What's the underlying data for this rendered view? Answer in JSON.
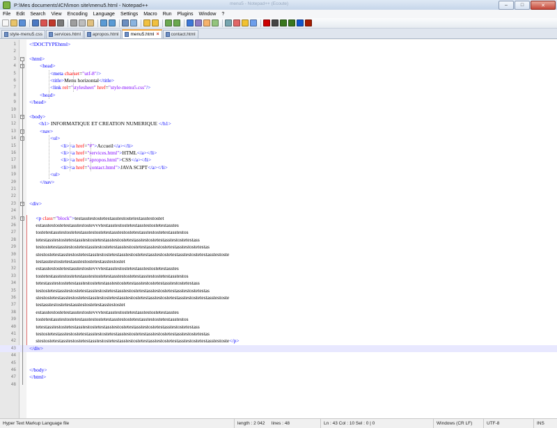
{
  "window": {
    "title": "P:\\Mes documents\\ICN\\mon site\\menu5.html - Notepad++",
    "ghost_title": "menu5 - Notepad++ (Ecoute)",
    "minimize": "–",
    "maximize": "□",
    "close": "✕"
  },
  "menu": [
    "File",
    "Edit",
    "Search",
    "View",
    "Encoding",
    "Language",
    "Settings",
    "Macro",
    "Run",
    "Plugins",
    "Window",
    "?"
  ],
  "toolbar": {
    "icons": [
      "new-file-icon",
      "open-file-icon",
      "save-icon",
      "save-all-icon",
      "close-icon",
      "close-all-icon",
      "print-icon",
      "cut-icon",
      "copy-icon",
      "paste-icon",
      "undo-icon",
      "redo-icon",
      "find-icon",
      "replace-icon",
      "zoom-in-icon",
      "zoom-out-icon",
      "sync-v-icon",
      "sync-h-icon",
      "word-wrap-icon",
      "show-all-icon",
      "indent-guide-icon",
      "user-lang-icon",
      "doc-map-icon",
      "function-list-icon",
      "folder-icon",
      "monitor-icon",
      "record-macro-icon",
      "stop-record-icon",
      "play-macro-icon",
      "run-macro-icon",
      "save-macro-icon",
      "abc-icon"
    ]
  },
  "tabs": [
    {
      "label": "style-menu5.css",
      "active": false
    },
    {
      "label": "services.html",
      "active": false
    },
    {
      "label": "apropos.html",
      "active": false
    },
    {
      "label": "menu5.html",
      "active": true
    },
    {
      "label": "contact.html",
      "active": false
    }
  ],
  "editor": {
    "current_line": 43,
    "lines": [
      [
        [
          "t",
          "<"
        ],
        [
          "t",
          "!DOCTYPEhtml"
        ],
        [
          "t",
          ">"
        ]
      ],
      [],
      [
        [
          "t",
          "<html>"
        ]
      ],
      [
        [
          "x",
          "        "
        ],
        [
          "t",
          "<head>"
        ]
      ],
      [
        [
          "x",
          "                "
        ],
        [
          "t",
          "<meta "
        ],
        [
          "a",
          "charset"
        ],
        [
          "x",
          "="
        ],
        [
          "v",
          "\"utf-8\""
        ],
        [
          "t",
          "/>"
        ]
      ],
      [
        [
          "x",
          "                "
        ],
        [
          "t",
          "<title>"
        ],
        [
          "x",
          "Menu horizontal"
        ],
        [
          "t",
          "</title>"
        ]
      ],
      [
        [
          "x",
          "                "
        ],
        [
          "t",
          "<link "
        ],
        [
          "a",
          "rel"
        ],
        [
          "x",
          "="
        ],
        [
          "v",
          "\"stylesheet\""
        ],
        [
          "x",
          " "
        ],
        [
          "a",
          "href"
        ],
        [
          "x",
          "="
        ],
        [
          "v",
          "\"style-menu5.css\""
        ],
        [
          "t",
          "/>"
        ]
      ],
      [
        [
          "x",
          "        "
        ],
        [
          "t",
          "<head>"
        ]
      ],
      [
        [
          "t",
          "</head>"
        ]
      ],
      [],
      [
        [
          "t",
          "<body>"
        ]
      ],
      [
        [
          "x",
          "       "
        ],
        [
          "t",
          "<h1>"
        ],
        [
          "x",
          " INFORMATIQUE ET CREATION NUMERIQUE "
        ],
        [
          "t",
          "</h1>"
        ]
      ],
      [
        [
          "x",
          "        "
        ],
        [
          "t",
          "<nav>"
        ]
      ],
      [
        [
          "x",
          "                "
        ],
        [
          "t",
          "<ul>"
        ]
      ],
      [
        [
          "x",
          "                        "
        ],
        [
          "t",
          "<li><a "
        ],
        [
          "a",
          "href"
        ],
        [
          "x",
          "="
        ],
        [
          "v",
          "\"#\""
        ],
        [
          "t",
          ">"
        ],
        [
          "x",
          "Accueil"
        ],
        [
          "t",
          "</a></li>"
        ]
      ],
      [
        [
          "x",
          "                        "
        ],
        [
          "t",
          "<li><a "
        ],
        [
          "a",
          "href"
        ],
        [
          "x",
          "="
        ],
        [
          "v",
          "\"services.html\""
        ],
        [
          "t",
          ">"
        ],
        [
          "x",
          "HTML"
        ],
        [
          "t",
          "</a></li>"
        ]
      ],
      [
        [
          "x",
          "                        "
        ],
        [
          "t",
          "<li><a "
        ],
        [
          "a",
          "href"
        ],
        [
          "x",
          "="
        ],
        [
          "v",
          "\"apropos.html\""
        ],
        [
          "t",
          ">"
        ],
        [
          "x",
          "CSS"
        ],
        [
          "t",
          "</a></li>"
        ]
      ],
      [
        [
          "x",
          "                        "
        ],
        [
          "t",
          "<li><a "
        ],
        [
          "a",
          "href"
        ],
        [
          "x",
          "="
        ],
        [
          "v",
          "\"contact.html\""
        ],
        [
          "t",
          ">"
        ],
        [
          "x",
          "JAVA SCIPT"
        ],
        [
          "t",
          "</a></li>"
        ]
      ],
      [
        [
          "x",
          "                "
        ],
        [
          "t",
          "<ul>"
        ]
      ],
      [
        [
          "x",
          "        "
        ],
        [
          "t",
          "</nav>"
        ]
      ],
      [],
      [],
      [
        [
          "t",
          "<div>"
        ]
      ],
      [],
      [
        [
          "x",
          "     "
        ],
        [
          "t",
          "<p "
        ],
        [
          "a",
          "class"
        ],
        [
          "x",
          "="
        ],
        [
          "v",
          "\"block\""
        ],
        [
          "t",
          ">"
        ],
        [
          "x",
          "testasstestostetestasstestostetestasstestostet"
        ]
      ],
      [
        [
          "x",
          "     estasstestostetestasstestostevvvtestasstestostetestasstestostetestasstes"
        ]
      ],
      [
        [
          "x",
          "     tostetestasstestostetestasstestostetestasstestostetestasstestostetestasstestos"
        ]
      ],
      [
        [
          "x",
          "     tetestasstestostetestasstestostetestasstestostetestasstestostetestasstestostetestass"
        ]
      ],
      [
        [
          "x",
          "     testostetestasstestostetestasstestostetestasstestostetestasstestostetestasstestostetestas"
        ]
      ],
      [
        [
          "x",
          "     stestostetestasstestostetestasstestostetestasstestostetestasstestostetestasstestostetestasstestoste"
        ]
      ],
      [
        [
          "x",
          "     testasstestostetestasstestostetestasstestostet"
        ]
      ],
      [
        [
          "x",
          "     estasstestostetestasstestostevvvtestasstestostetestasstestostetestasstes"
        ]
      ],
      [
        [
          "x",
          "     tostetestasstestostetestasstestostetestasstestostetestasstestostetestasstestos"
        ]
      ],
      [
        [
          "x",
          "     tetestasstestostetestasstestostetestasstestostetestasstestostetestasstestostetestass"
        ]
      ],
      [
        [
          "x",
          "     testostetestasstestostetestasstestostetestasstestostetestasstestostetestasstestostetestas"
        ]
      ],
      [
        [
          "x",
          "     stestostetestasstestostetestasstestostetestasstestostetestasstestostetestasstestostetestasstestoste"
        ]
      ],
      [
        [
          "x",
          "     testasstestostetestasstestostetestasstestostet"
        ]
      ],
      [
        [
          "x",
          "     estasstestostetestasstestostevvvtestasstestostetestasstestostetestasstes"
        ]
      ],
      [
        [
          "x",
          "     tostetestasstestostetestasstestostetestasstestostetestasstestostetestasstestos"
        ]
      ],
      [
        [
          "x",
          "     tetestasstestostetestasstestostetestasstestostetestasstestostetestasstestostetestass"
        ]
      ],
      [
        [
          "x",
          "     testostetestasstestostetestasstestostetestasstestostetestasstestostetestasstestostetestas"
        ]
      ],
      [
        [
          "x",
          "     stestostetestasstestostetestasstestostetestasstestostetestasstestostetestasstestostetestasstestoste"
        ],
        [
          "t",
          "</p>"
        ]
      ],
      [
        [
          "t",
          "</div>"
        ]
      ],
      [],
      [],
      [
        [
          "t",
          "</body>"
        ]
      ],
      [
        [
          "t",
          "</html>"
        ]
      ],
      []
    ]
  },
  "status": {
    "lang": "Hyper Text Markup Language file",
    "length": "length : 2 042",
    "lines": "lines : 48",
    "pos": "Ln : 43    Col : 10    Sel : 0 | 0",
    "eol": "Windows (CR LF)",
    "encoding": "UTF-8",
    "mode": "INS"
  },
  "colors": {
    "tag": "#0000ff",
    "attr": "#ff0000",
    "value": "#8000ff",
    "current_line": "#e8e8ff",
    "accent": "#f2a33a"
  }
}
